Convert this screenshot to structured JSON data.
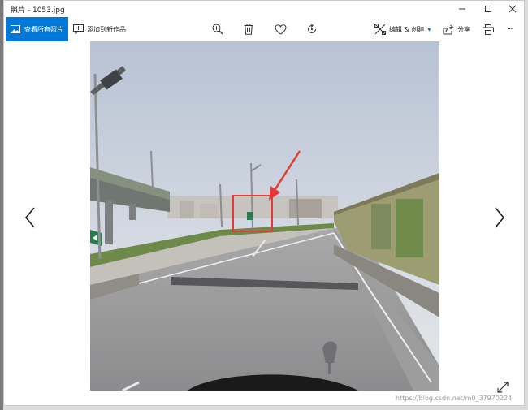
{
  "window": {
    "title": "照片 - 1053.jpg"
  },
  "toolbar": {
    "view_all_label": "查看所有照片",
    "add_label": "添加到新作品",
    "edit_label": "编辑 & 创建",
    "share_label": "分享",
    "more_label": "···"
  },
  "watermark": "https://blog.csdn.net/m0_37970224",
  "colors": {
    "accent": "#0078d7",
    "annotation": "#e53935"
  },
  "icons": [
    "picture-icon",
    "add-to-creation-icon",
    "zoom-icon",
    "trash-icon",
    "heart-icon",
    "rotate-icon",
    "edit-create-icon",
    "share-icon",
    "print-icon",
    "more-icon",
    "chevron-left-icon",
    "chevron-right-icon",
    "expand-icon"
  ]
}
